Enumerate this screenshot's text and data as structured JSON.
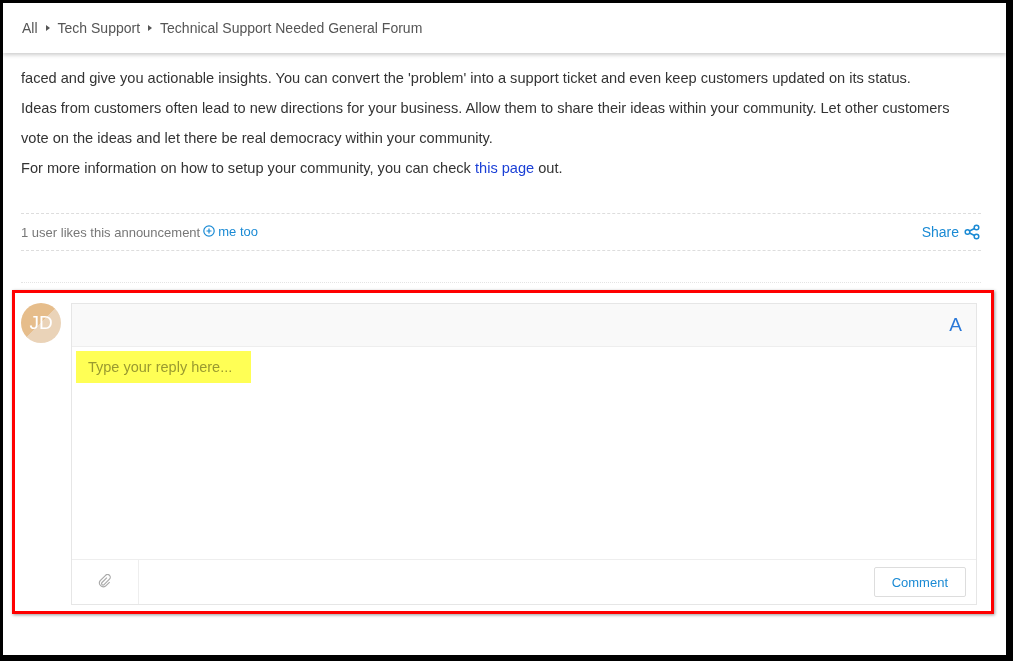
{
  "breadcrumbs": [
    {
      "label": "All"
    },
    {
      "label": "Tech Support"
    },
    {
      "label": "Technical Support Needed General Forum"
    }
  ],
  "post": {
    "paragraphs": [
      {
        "text": "faced and give you actionable insights. You can convert the 'problem' into a support ticket and even keep customers updated on its status."
      },
      {
        "text": "Ideas from customers often lead to new directions for your business. Allow them to share their ideas within your community. Let other customers vote on the ideas and let there be real democracy within your community."
      },
      {
        "text": "For more information on how to setup your community, you can check ",
        "link": "this page",
        "after": " out."
      }
    ]
  },
  "likes": {
    "text": "1 user likes this announcement",
    "action": "me too"
  },
  "share": "Share",
  "reply": {
    "avatar": "JD",
    "format_button": "A",
    "placeholder": "Type your reply here...",
    "highlighted": true,
    "comment_button": "Comment"
  }
}
